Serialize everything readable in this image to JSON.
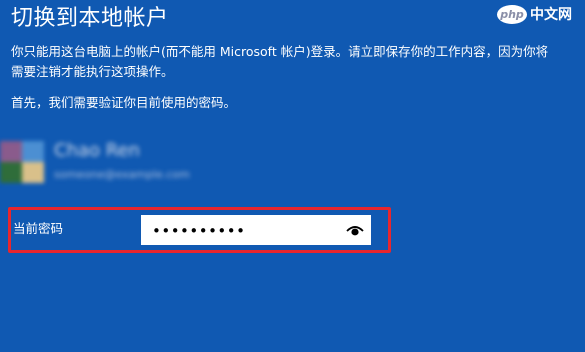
{
  "title": "切换到本地帐户",
  "description": "你只能用这台电脑上的帐户(而不能用 Microsoft 帐户)登录。请立即保存你的工作内容，因为你将需要注销才能执行这项操作。",
  "verify_text": "首先，我们需要验证你目前使用的密码。",
  "account": {
    "name": "Chao Ren",
    "email": "someone@example.com"
  },
  "password": {
    "label": "当前密码",
    "value": "••••••••••",
    "reveal_icon": "eye-icon"
  },
  "watermark": {
    "logo": "php",
    "text": "中文网"
  },
  "colors": {
    "background": "#1059b2",
    "highlight_border": "#e8262d",
    "text": "#ffffff"
  }
}
